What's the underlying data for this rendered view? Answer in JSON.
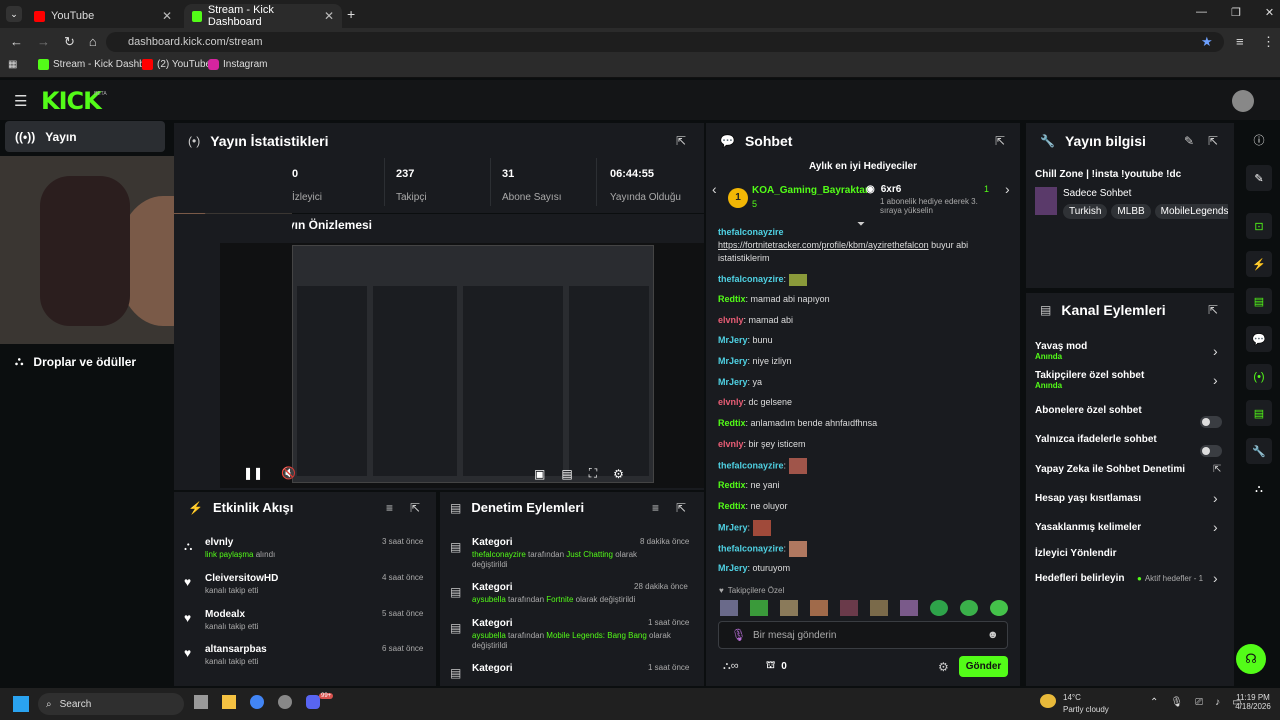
{
  "browser": {
    "tabs": [
      {
        "label": "YouTube"
      },
      {
        "label": "Stream - Kick Dashboard"
      }
    ],
    "url": "dashboard.kick.com/stream",
    "bookmarks": [
      "Stream - Kick Dashb...",
      "(2) YouTube",
      "Instagram"
    ]
  },
  "app": {
    "logo": "KICK",
    "beta": "BETA"
  },
  "left_nav": {
    "items": [
      "Yayın",
      "Droplar ve ödüller"
    ]
  },
  "stats": {
    "title": "Yayın İstatistikleri",
    "items": [
      {
        "value": "0",
        "label": "İzleyici"
      },
      {
        "value": "237",
        "label": "Takipçi"
      },
      {
        "value": "31",
        "label": "Abone Sayısı"
      },
      {
        "value": "06:44:55",
        "label": "Yayında Olduğu"
      }
    ]
  },
  "preview": {
    "title": "Yayın Önizlemesi"
  },
  "activity": {
    "title": "Etkinlik Akışı",
    "items": [
      {
        "user": "elvnly",
        "detail_green": "link paylaşma",
        "detail": " alındı",
        "time": "3 saat önce"
      },
      {
        "user": "CleiversitowHD",
        "detail_green": "",
        "detail": "kanalı takip etti",
        "time": "4 saat önce"
      },
      {
        "user": "Modealx",
        "detail_green": "",
        "detail": "kanalı takip etti",
        "time": "5 saat önce"
      },
      {
        "user": "altansarpbas",
        "detail_green": "",
        "detail": "kanalı takip etti",
        "time": "6 saat önce"
      }
    ]
  },
  "moderation": {
    "title": "Denetim Eylemleri",
    "items": [
      {
        "title": "Kategori",
        "time": "8 dakika önce",
        "user": "thefalconayzire",
        "mid": " tarafından ",
        "cat": "Just Chatting",
        "end": " olarak değiştirildi"
      },
      {
        "title": "Kategori",
        "time": "28 dakika önce",
        "user": "aysubella",
        "mid": " tarafından ",
        "cat": "Fortnite",
        "end": " olarak değiştirildi"
      },
      {
        "title": "Kategori",
        "time": "1 saat önce",
        "user": "aysubella",
        "mid": " tarafından ",
        "cat": "Mobile Legends: Bang Bang",
        "end": " olarak değiştirildi"
      },
      {
        "title": "Kategori",
        "time": "1 saat önce",
        "user": "",
        "mid": "",
        "cat": "",
        "end": ""
      }
    ]
  },
  "chat": {
    "title": "Sohbet",
    "gifters_title": "Aylık en iyi Hediyeciler",
    "top_gifter": "KOA_Gaming_Bayraktar",
    "top_gifter_count": "5",
    "second": "6xr6",
    "second_count": "1",
    "second_note": "1 abonelik hediye ederek 3. sıraya yükselin",
    "messages": [
      {
        "user": "thefalconayzire",
        "cls": "cyan",
        "text": "",
        "link": "https://fortnitetracker.com/profile/kbm/ayzirethefalcon",
        "after": " buyur abi istatistiklerim"
      },
      {
        "user": "thefalconayzire",
        "cls": "cyan",
        "text": "",
        "emote": true
      },
      {
        "user": "Redtix",
        "cls": "green",
        "text": "mamad abi napıyon"
      },
      {
        "user": "elvnly",
        "cls": "red",
        "text": "mamad abi"
      },
      {
        "user": "MrJery",
        "cls": "cyan",
        "text": "bunu"
      },
      {
        "user": "MrJery",
        "cls": "cyan",
        "text": "niye izliyn"
      },
      {
        "user": "MrJery",
        "cls": "cyan",
        "text": "ya"
      },
      {
        "user": "elvnly",
        "cls": "red",
        "text": "dc gelsene"
      },
      {
        "user": "Redtix",
        "cls": "green",
        "text": "anlamadım bende ahnfaıdfhnsa"
      },
      {
        "user": "elvnly",
        "cls": "red",
        "text": "bir şey isticem"
      },
      {
        "user": "thefalconayzire",
        "cls": "cyan",
        "text": "",
        "emote": true
      },
      {
        "user": "Redtix",
        "cls": "green",
        "text": "ne yani"
      },
      {
        "user": "Redtix",
        "cls": "green",
        "text": "ne oluyor"
      },
      {
        "user": "MrJery",
        "cls": "cyan",
        "text": "",
        "emote": true
      },
      {
        "user": "thefalconayzire",
        "cls": "cyan",
        "text": "",
        "emote": true
      },
      {
        "user": "MrJery",
        "cls": "cyan",
        "text": "oturuyom"
      }
    ],
    "followers_only": "Takipçilere Özel",
    "input_placeholder": "Bir mesaj gönderin",
    "points": "0",
    "send": "Gönder"
  },
  "info": {
    "title": "Yayın bilgisi",
    "stream_title": "Chill Zone | !insta !youtube !dc",
    "category": "Sadece Sohbet",
    "tags": [
      "Turkish",
      "MLBB",
      "MobileLegends"
    ]
  },
  "actions": {
    "title": "Kanal Eylemleri",
    "items": [
      {
        "label": "Yavaş mod",
        "sub": "Anında"
      },
      {
        "label": "Takipçilere özel sohbet",
        "sub": "Anında"
      },
      {
        "label": "Abonelere özel sohbet",
        "sub": ""
      },
      {
        "label": "Yalnızca ifadelerle sohbet",
        "sub": ""
      },
      {
        "label": "Yapay Zeka ile Sohbet Denetimi",
        "sub": ""
      },
      {
        "label": "Hesap yaşı kısıtlaması",
        "sub": ""
      },
      {
        "label": "Yasaklanmış kelimeler",
        "sub": ""
      },
      {
        "label": "İzleyici Yönlendir",
        "sub": ""
      },
      {
        "label": "Hedefleri belirleyin",
        "sub": "",
        "extra": "Aktif hedefler - 1"
      }
    ]
  },
  "taskbar": {
    "search": "Search",
    "weather_temp": "14°C",
    "weather_desc": "Partly cloudy",
    "time": "11:19 PM",
    "date": "4/18/2026",
    "badge": "99+"
  }
}
